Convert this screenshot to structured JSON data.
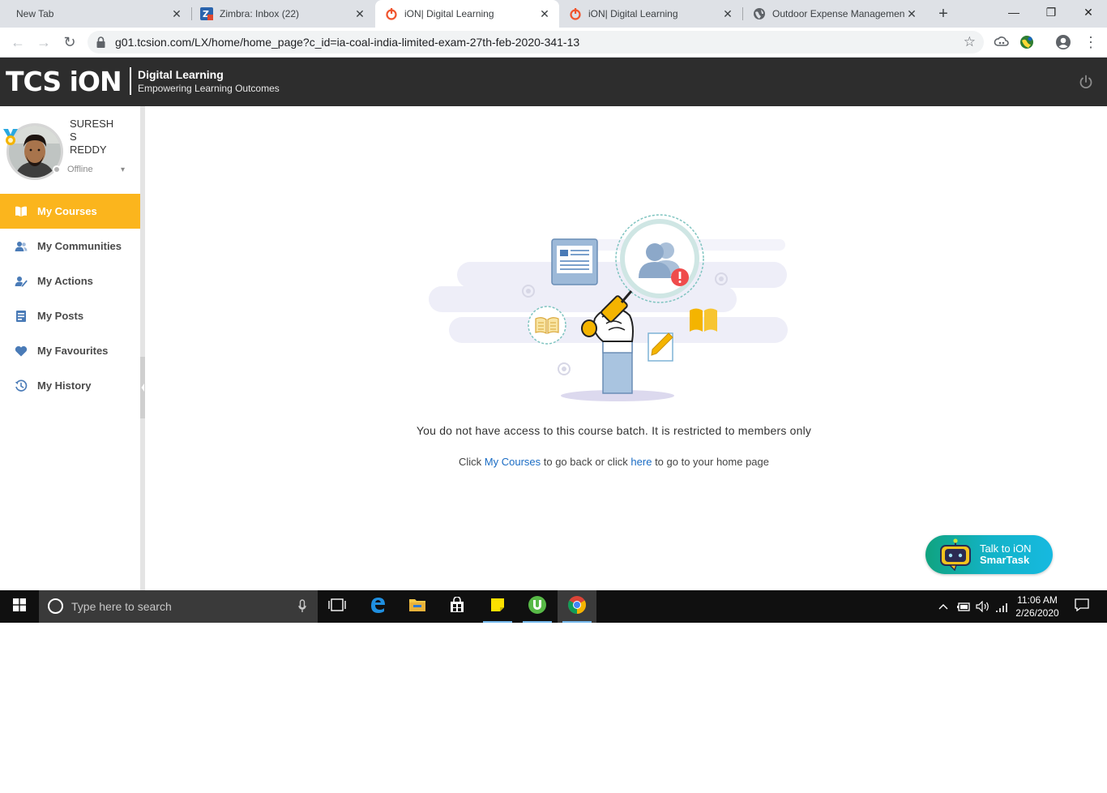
{
  "browser": {
    "tabs": [
      {
        "label": "New Tab",
        "favicon": "none"
      },
      {
        "label": "Zimbra: Inbox (22)",
        "favicon": "zimbra-icon"
      },
      {
        "label": "iON| Digital Learning",
        "favicon": "ion-power-icon"
      },
      {
        "label": "iON| Digital Learning",
        "favicon": "ion-power-icon"
      },
      {
        "label": "Outdoor Expense Managemen",
        "favicon": "globe-icon"
      }
    ],
    "active_tab_index": 2,
    "close_glyph": "✕",
    "new_tab_glyph": "+",
    "url": "g01.tcsion.com/LX/home/home_page?c_id=ia-coal-india-limited-exam-27th-feb-2020-341-13",
    "window_controls": {
      "minimize": "—",
      "maximize": "❐",
      "close": "✕"
    },
    "nav": {
      "back": "←",
      "forward": "→",
      "reload": "↻",
      "star": "☆",
      "menu": "⋮"
    }
  },
  "header": {
    "logo_text": "TCS iON",
    "brand_title": "Digital Learning",
    "brand_subtitle": "Empowering Learning Outcomes",
    "bg_color": "#2d2d2d"
  },
  "user": {
    "name": "SURESH S REDDY",
    "name_lines": [
      "SURESH",
      "S",
      "REDDY"
    ],
    "status": "Offline",
    "caret": "▾"
  },
  "sidebar": {
    "items": [
      {
        "label": "My Courses",
        "icon": "book-icon",
        "active": true
      },
      {
        "label": "My Communities",
        "icon": "people-icon",
        "active": false
      },
      {
        "label": "My Actions",
        "icon": "actions-icon",
        "active": false
      },
      {
        "label": "My Posts",
        "icon": "posts-icon",
        "active": false
      },
      {
        "label": "My Favourites",
        "icon": "heart-icon",
        "active": false
      },
      {
        "label": "My History",
        "icon": "history-icon",
        "active": false
      }
    ],
    "accent": "#fbb51d"
  },
  "main": {
    "message": "You do not have access to this course batch. It is restricted to members only",
    "hint_prefix": "Click ",
    "hint_link1": "My Courses",
    "hint_mid": " to go back or click ",
    "hint_link2": "here",
    "hint_suffix": " to go to your home page",
    "link_color": "#1a6cc4"
  },
  "chatbot": {
    "line1": "Talk to iON",
    "line2": "SmarTask"
  },
  "taskbar": {
    "search_placeholder": "Type here to search",
    "time": "11:06 AM",
    "date": "2/26/2020",
    "tray_up": "^"
  }
}
